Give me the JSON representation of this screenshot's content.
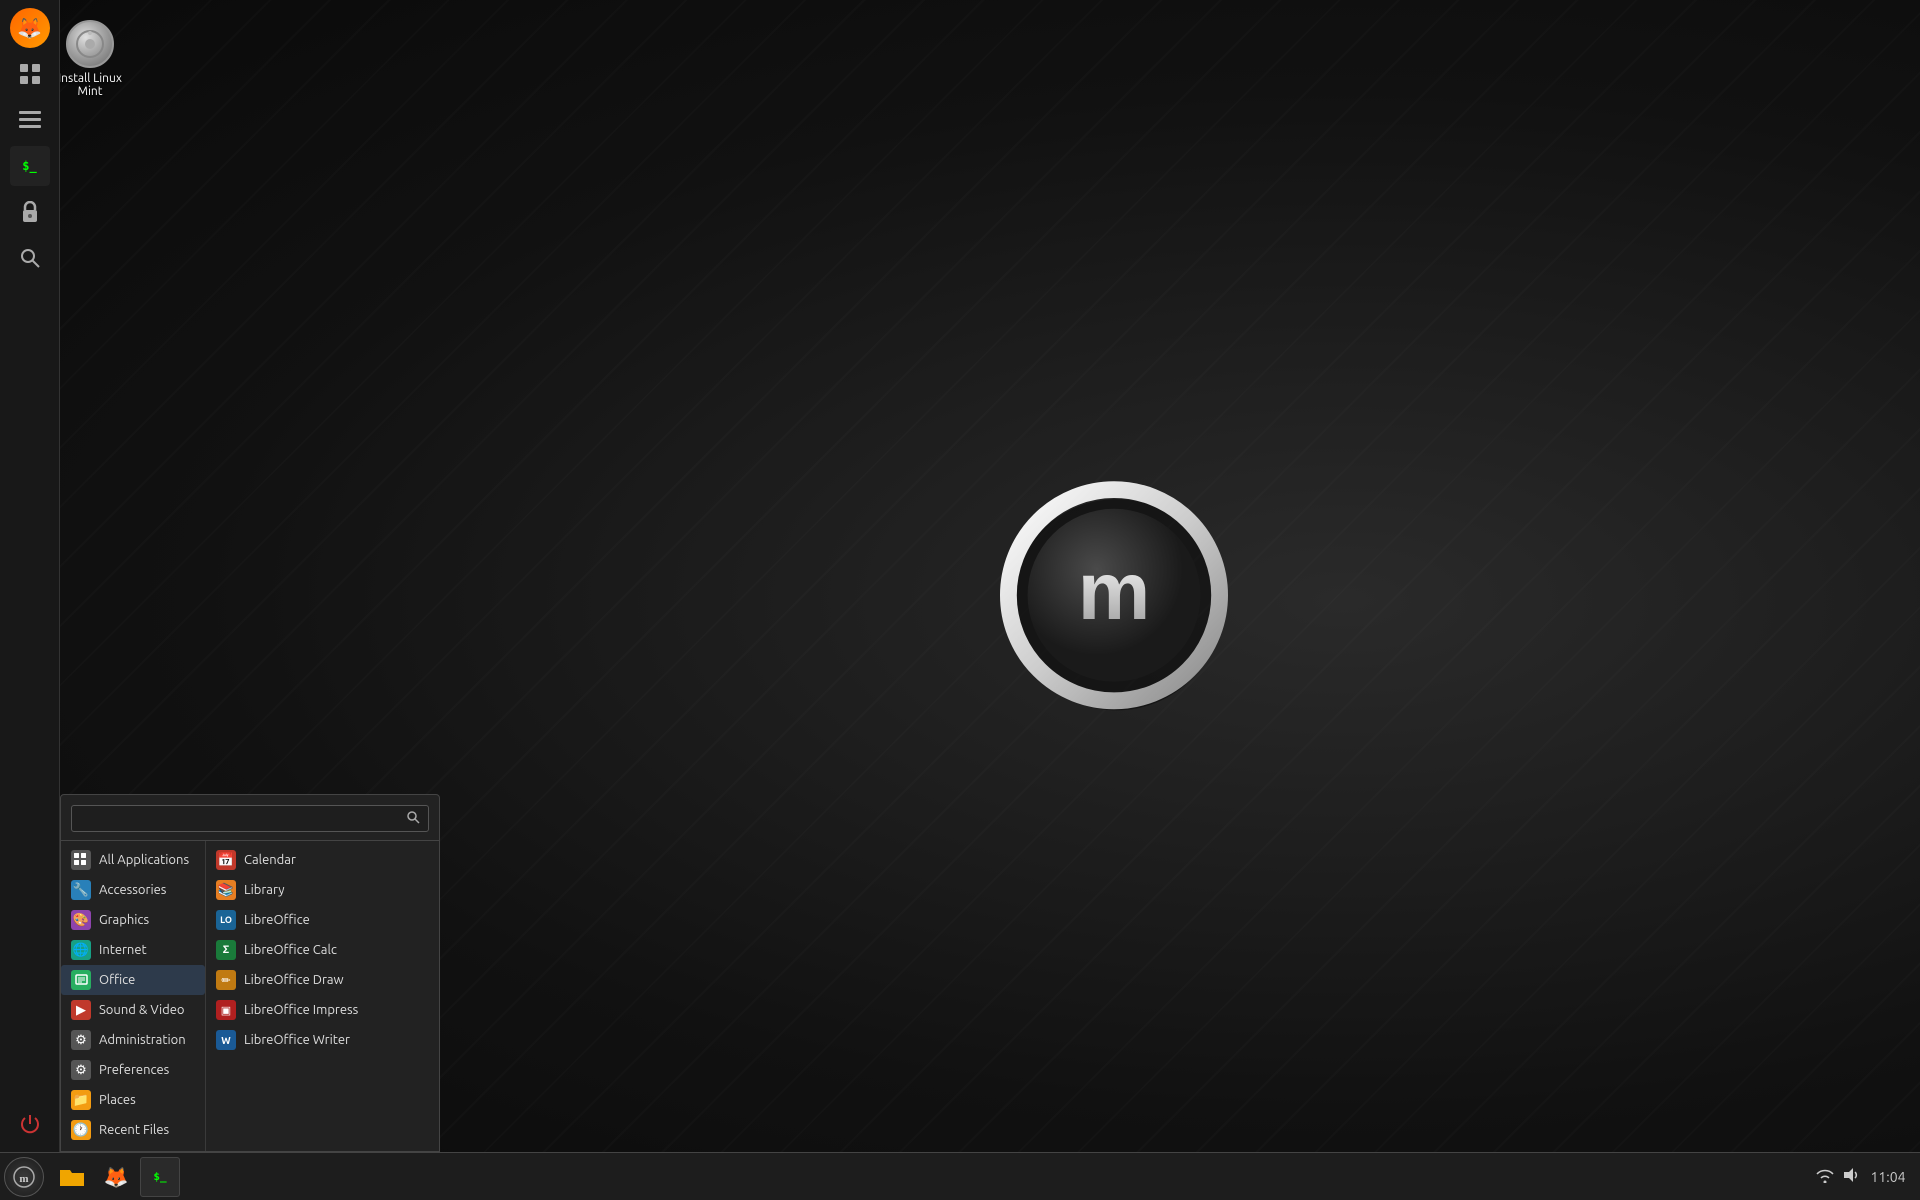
{
  "desktop": {
    "icon": {
      "label": "Install Linux Mint"
    }
  },
  "sidebar": {
    "icons": [
      {
        "name": "firefox-icon",
        "symbol": "🦊",
        "color": "#e55"
      },
      {
        "name": "grid-icon",
        "symbol": "⊞",
        "color": "#aaa"
      },
      {
        "name": "stack-icon",
        "symbol": "☰",
        "color": "#aaa"
      },
      {
        "name": "terminal-icon",
        "symbol": ">_",
        "color": "#0f0"
      },
      {
        "name": "lock-icon",
        "symbol": "🔒",
        "color": "#aaa"
      },
      {
        "name": "search-icon",
        "symbol": "⊕",
        "color": "#aaa"
      },
      {
        "name": "power-icon",
        "symbol": "⏻",
        "color": "#c33"
      }
    ]
  },
  "start_menu": {
    "search_placeholder": "",
    "left_items": [
      {
        "id": "all-applications",
        "label": "All Applications",
        "icon": "⊞",
        "icon_class": "icon-gray",
        "active": false
      },
      {
        "id": "accessories",
        "label": "Accessories",
        "icon": "🔧",
        "icon_class": "icon-blue"
      },
      {
        "id": "graphics",
        "label": "Graphics",
        "icon": "🎨",
        "icon_class": "icon-purple"
      },
      {
        "id": "internet",
        "label": "Internet",
        "icon": "🌐",
        "icon_class": "icon-cyan"
      },
      {
        "id": "office",
        "label": "Office",
        "icon": "📄",
        "icon_class": "icon-green",
        "active": true
      },
      {
        "id": "sound-video",
        "label": "Sound & Video",
        "icon": "▶",
        "icon_class": "icon-red"
      },
      {
        "id": "administration",
        "label": "Administration",
        "icon": "⚙",
        "icon_class": "icon-gray"
      },
      {
        "id": "preferences",
        "label": "Preferences",
        "icon": "⚙",
        "icon_class": "icon-gray"
      },
      {
        "id": "places",
        "label": "Places",
        "icon": "📁",
        "icon_class": "icon-yellow"
      },
      {
        "id": "recent-files",
        "label": "Recent Files",
        "icon": "🕐",
        "icon_class": "icon-yellow"
      }
    ],
    "right_items": [
      {
        "id": "calendar",
        "label": "Calendar",
        "icon": "📅",
        "icon_class": "icon-red"
      },
      {
        "id": "library",
        "label": "Library",
        "icon": "📚",
        "icon_class": "icon-orange"
      },
      {
        "id": "libreoffice",
        "label": "LibreOffice",
        "icon": "LO",
        "icon_class": "icon-lo"
      },
      {
        "id": "libreoffice-calc",
        "label": "LibreOffice Calc",
        "icon": "Σ",
        "icon_class": "icon-lo-calc"
      },
      {
        "id": "libreoffice-draw",
        "label": "LibreOffice Draw",
        "icon": "✏",
        "icon_class": "icon-lo-draw"
      },
      {
        "id": "libreoffice-impress",
        "label": "LibreOffice Impress",
        "icon": "▣",
        "icon_class": "icon-lo-impress"
      },
      {
        "id": "libreoffice-writer",
        "label": "LibreOffice Writer",
        "icon": "W",
        "icon_class": "icon-lo-writer"
      }
    ]
  },
  "taskbar": {
    "start_label": "",
    "time": "11:04",
    "taskbar_items": [
      {
        "name": "folder-btn",
        "label": "📁"
      },
      {
        "name": "firefox-btn",
        "label": "🦊"
      },
      {
        "name": "terminal-btn",
        "label": ">_"
      }
    ]
  }
}
